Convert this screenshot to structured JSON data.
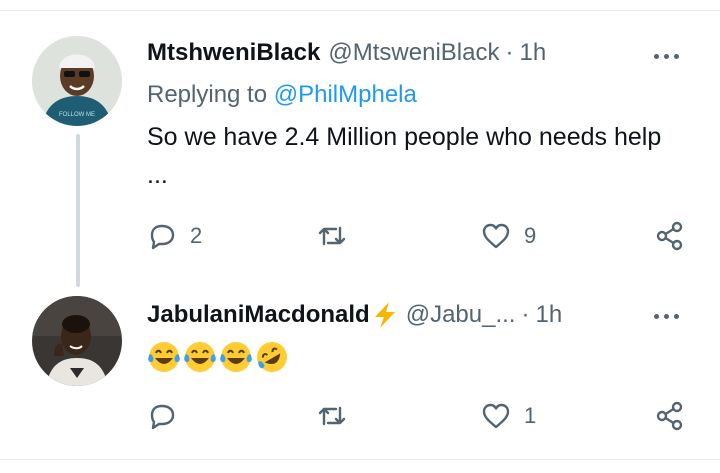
{
  "colors": {
    "text_primary": "#0f1419",
    "text_secondary": "#536471",
    "link": "#1d9bf0",
    "thread_line": "#cfd9de",
    "bolt": "#f7b500"
  },
  "tweets": [
    {
      "display_name": "MtshweniBlack",
      "handle": "@MtsweniBlack",
      "separator": "·",
      "time": "1h",
      "replying_prefix": "Replying to",
      "replying_mention": "@PhilMphela",
      "text": "So we have 2.4 Million people who needs help ...",
      "replies": "2",
      "retweets": "",
      "likes": "9",
      "icons": [
        "reply-icon",
        "retweet-icon",
        "like-icon",
        "share-icon",
        "more-icon"
      ]
    },
    {
      "display_name": "JabulaniMacdonald",
      "name_emoji": "high-voltage-emoji",
      "handle": "@Jabu_...",
      "separator": "·",
      "time": "1h",
      "emojis": [
        "face-with-tears-of-joy",
        "face-with-tears-of-joy",
        "face-with-tears-of-joy",
        "rolling-on-the-floor-laughing"
      ],
      "replies": "",
      "retweets": "",
      "likes": "1",
      "icons": [
        "reply-icon",
        "retweet-icon",
        "like-icon",
        "share-icon",
        "more-icon"
      ]
    }
  ]
}
